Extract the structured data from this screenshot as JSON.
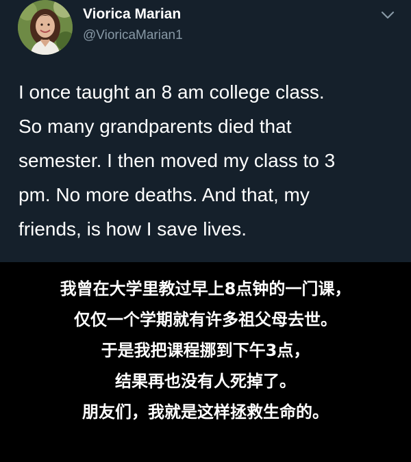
{
  "tweet": {
    "author": {
      "display_name": "Viorica Marian",
      "handle": "@VioricaMarian1",
      "avatar_icon": "profile-photo"
    },
    "menu_icon": "chevron-down-icon",
    "text_lines": [
      "I once taught an 8 am college class.",
      "So many grandparents died that",
      "semester. I then moved my class to 3",
      "pm. No more deaths. And that, my",
      "friends, is how I save lives."
    ]
  },
  "caption": {
    "lines": [
      "我曾在大学里教过早上8点钟的一门课，",
      "仅仅一个学期就有许多祖父母去世。",
      "于是我把课程挪到下午3点，",
      "结果再也没有人死掉了。",
      "朋友们，我就是这样拯救生命的。"
    ]
  },
  "colors": {
    "tweet_background": "#15202b",
    "caption_background": "#000000",
    "handle_gray": "#8899a6",
    "text_white": "#ffffff"
  }
}
